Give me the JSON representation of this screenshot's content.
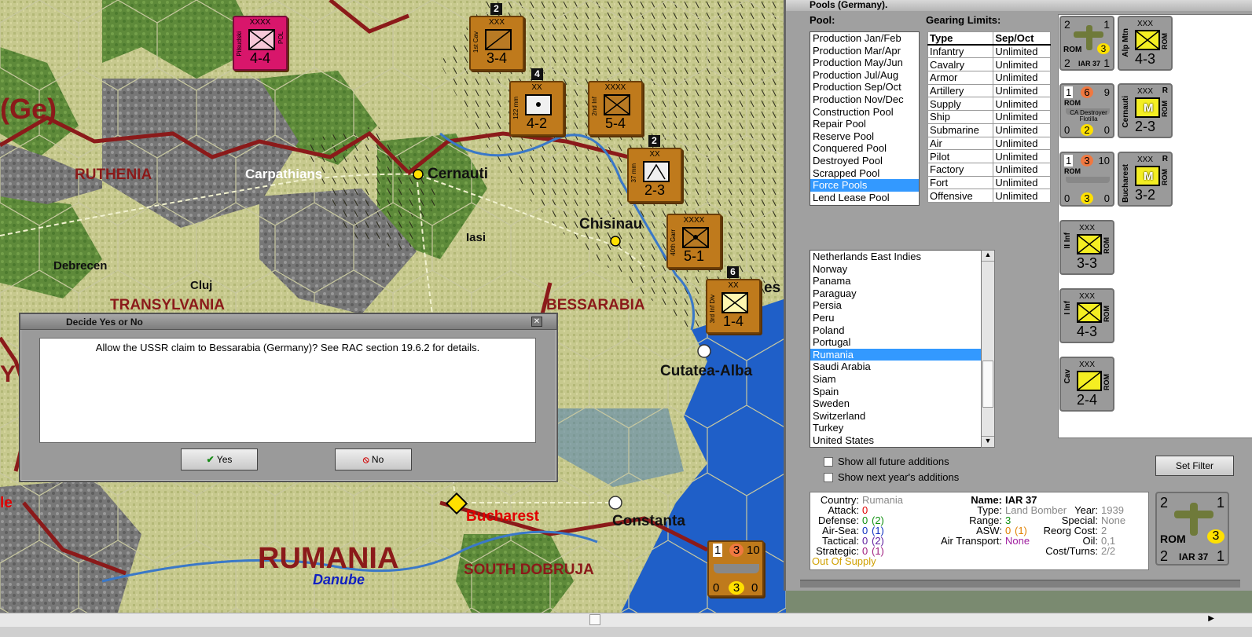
{
  "map": {
    "regions": [
      "(Ge)",
      "RUTHENIA",
      "Carpathians",
      "Debrecen",
      "Cluj",
      "TRANSYLVANIA",
      "BESSARABIA",
      "RUMANIA",
      "SOUTH DOBRUJA",
      "Danube"
    ],
    "cities": [
      "Cernauti",
      "Iasi",
      "Chisinau",
      "Cutatea-Alba",
      "Bucharest",
      "Constanta"
    ],
    "edge_text": [
      "Y",
      "le",
      "es"
    ],
    "counters": [
      {
        "size": "XXXX",
        "side": "Pilsudski",
        "country": "POL",
        "value": "4-4"
      },
      {
        "size": "XXX",
        "side": "1st Cav",
        "value": "3-4",
        "stack": "2"
      },
      {
        "size": "XX",
        "side": "122 mm",
        "value": "4-2",
        "stack": "4"
      },
      {
        "size": "XXXX",
        "side": "2nd Inf",
        "value": "5-4"
      },
      {
        "size": "XX",
        "side": "37 mm",
        "value": "2-3",
        "stack": "2"
      },
      {
        "size": "XXXX",
        "side": "40th Garr",
        "value": "5-1"
      },
      {
        "size": "XX",
        "side": "3rd Inf Div",
        "value": "1-4",
        "stack": "6"
      }
    ],
    "naval_counter": {
      "top": [
        "1",
        "3",
        "10"
      ],
      "bottom": [
        "0",
        "3",
        "0"
      ]
    }
  },
  "dialog": {
    "title": "Decide Yes or No",
    "message": "Allow the USSR claim to Bessarabia (Germany)?  See RAC section 19.6.2 for details.",
    "yes": "Yes",
    "no": "No"
  },
  "panel": {
    "title": "Pools (Germany).",
    "pool_label": "Pool:",
    "gearing_label": "Gearing Limits:",
    "pools": [
      "Production Jan/Feb",
      "Production Mar/Apr",
      "Production May/Jun",
      "Production Jul/Aug",
      "Production Sep/Oct",
      "Production Nov/Dec",
      "Construction Pool",
      "Repair Pool",
      "Reserve Pool",
      "Conquered Pool",
      "Destroyed Pool",
      "Scrapped Pool",
      "Force Pools",
      "Lend Lease Pool"
    ],
    "pool_selected": "Force Pools",
    "gearing": {
      "headers": [
        "Type",
        "Sep/Oct"
      ],
      "rows": [
        [
          "Infantry",
          "Unlimited"
        ],
        [
          "Cavalry",
          "Unlimited"
        ],
        [
          "Armor",
          "Unlimited"
        ],
        [
          "Artillery",
          "Unlimited"
        ],
        [
          "Supply",
          "Unlimited"
        ],
        [
          "Ship",
          "Unlimited"
        ],
        [
          "Submarine",
          "Unlimited"
        ],
        [
          "Air",
          "Unlimited"
        ],
        [
          "Pilot",
          "Unlimited"
        ],
        [
          "Factory",
          "Unlimited"
        ],
        [
          "Fort",
          "Unlimited"
        ],
        [
          "Offensive",
          "Unlimited"
        ]
      ]
    },
    "countries": [
      "Netherlands East Indies",
      "Norway",
      "Panama",
      "Paraguay",
      "Persia",
      "Peru",
      "Poland",
      "Portugal",
      "Rumania",
      "Saudi Arabia",
      "Siam",
      "Spain",
      "Sweden",
      "Switzerland",
      "Turkey",
      "United States"
    ],
    "country_selected": "Rumania",
    "checkbox_future": "Show all future additions",
    "checkbox_next": "Show next year's additions",
    "set_filter": "Set Filter",
    "force_units": [
      {
        "kind": "air",
        "top": [
          "2",
          "1"
        ],
        "mid": "3",
        "country": "ROM",
        "bottom": [
          "2",
          "IAR 37",
          "1"
        ]
      },
      {
        "kind": "land",
        "size": "XXX",
        "side": "Alp Mtn",
        "country": "ROM",
        "value": "4-3"
      },
      {
        "kind": "naval",
        "top": [
          "1",
          "6",
          "9"
        ],
        "country": "ROM",
        "name": "CA Destroyer Flotilla",
        "bottom": [
          "0",
          "2",
          "0"
        ]
      },
      {
        "kind": "land",
        "size": "XXX",
        "side": "Cernauti",
        "country": "ROM",
        "value": "2-3",
        "mark": "M",
        "corner": "R"
      },
      {
        "kind": "naval",
        "top": [
          "1",
          "3",
          "10"
        ],
        "country": "ROM",
        "name": "",
        "bottom": [
          "0",
          "3",
          "0"
        ]
      },
      {
        "kind": "land",
        "size": "XXX",
        "side": "Bucharest",
        "country": "ROM",
        "value": "3-2",
        "mark": "M",
        "corner": "R"
      },
      {
        "kind": "land",
        "size": "XXX",
        "side": "II Inf",
        "country": "ROM",
        "value": "3-3"
      },
      {
        "kind": "land",
        "size": "XXX",
        "side": "I Inf",
        "country": "ROM",
        "value": "4-3"
      },
      {
        "kind": "land",
        "size": "XXX",
        "side": "Cav",
        "country": "ROM",
        "value": "2-4"
      }
    ],
    "info": {
      "country_k": "Country:",
      "country_v": "Rumania",
      "attack_k": "Attack:",
      "attack_v": "0",
      "defense_k": "Defense:",
      "defense_v": "0",
      "defense_p": "(2)",
      "airsea_k": "Air-Sea:",
      "airsea_v": "0",
      "airsea_p": "(1)",
      "tactical_k": "Tactical:",
      "tactical_v": "0",
      "tactical_p": "(2)",
      "strategic_k": "Strategic:",
      "strategic_v": "0",
      "strategic_p": "(1)",
      "supply": "Out Of Supply",
      "name_k": "Name:",
      "name_v": "IAR 37",
      "type_k": "Type:",
      "type_v": "Land Bomber",
      "range_k": "Range:",
      "range_v": "3",
      "asw_k": "ASW:",
      "asw_v": "0",
      "asw_p": "(1)",
      "airtrans_k": "Air Transport:",
      "airtrans_v": "None",
      "year_k": "Year:",
      "year_v": "1939",
      "special_k": "Special:",
      "special_v": "None",
      "reorg_k": "Reorg Cost:",
      "reorg_v": "2",
      "oil_k": "Oil:",
      "oil_v": "0,1",
      "cost_k": "Cost/Turns:",
      "cost_v": "2/2"
    },
    "big_unit": {
      "top": [
        "2",
        "1"
      ],
      "country": "ROM",
      "mid": "3",
      "bottom": [
        "2",
        "IAR 37",
        "1"
      ]
    }
  },
  "colors": {
    "counter": "#bf7a1c",
    "unit_yellow": "#f4ee22",
    "selection": "#3399ff",
    "border_red": "#8b1a1a",
    "sea": "#1f5fc8"
  }
}
